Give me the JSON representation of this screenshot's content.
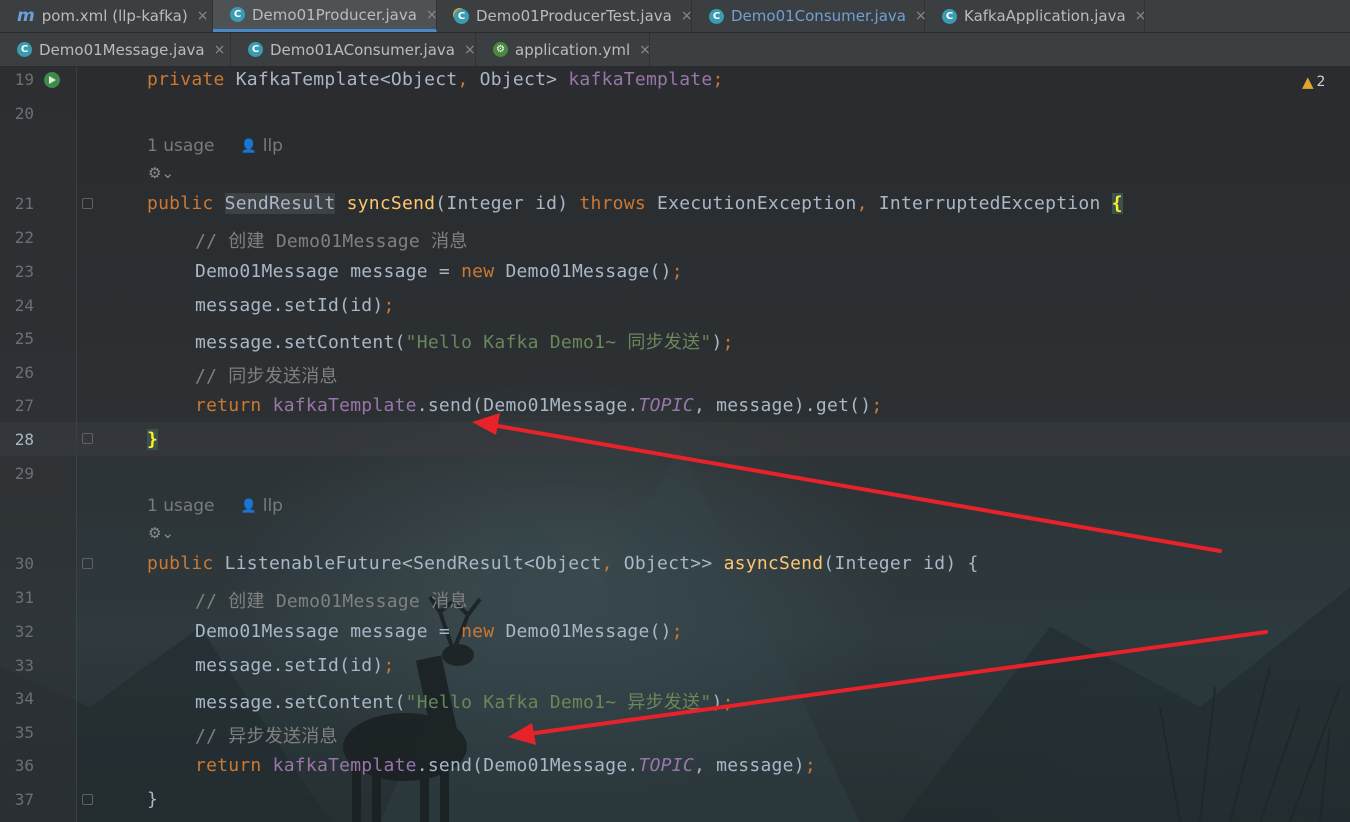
{
  "tabs_row1": [
    {
      "label": "pom.xml (llp-kafka)",
      "icon": "maven-icon",
      "glyph": "m",
      "active": false
    },
    {
      "label": "Demo01Producer.java",
      "icon": "class-icon",
      "glyph": "C",
      "active": true
    },
    {
      "label": "Demo01ProducerTest.java",
      "icon": "test-class-icon",
      "glyph": "C",
      "active": false
    },
    {
      "label": "Demo01Consumer.java",
      "icon": "class-icon",
      "glyph": "C",
      "active": false
    },
    {
      "label": "KafkaApplication.java",
      "icon": "spring-boot-app-icon",
      "glyph": "C",
      "active": false
    }
  ],
  "tabs_row2": [
    {
      "label": "Demo01Message.java",
      "icon": "class-icon",
      "glyph": "C"
    },
    {
      "label": "Demo01AConsumer.java",
      "icon": "class-icon",
      "glyph": "C"
    },
    {
      "label": "application.yml",
      "icon": "yaml-icon",
      "glyph": "⚙"
    }
  ],
  "close_glyph": "×",
  "warning": {
    "count": "2",
    "icon": "warning-icon",
    "glyph": "▲"
  },
  "line_numbers": [
    "19",
    "20",
    "21",
    "22",
    "23",
    "24",
    "25",
    "26",
    "27",
    "28",
    "29",
    "30",
    "31",
    "32",
    "33",
    "34",
    "35",
    "36",
    "37"
  ],
  "current_line": "28",
  "inlay_hints": [
    {
      "usages": "1 usage",
      "author": "llp",
      "person_glyph": "👤",
      "ai_glyph": "⚙⌄"
    },
    {
      "usages": "1 usage",
      "author": "llp",
      "person_glyph": "👤",
      "ai_glyph": "⚙⌄"
    }
  ],
  "code": {
    "l19": {
      "kw": "private ",
      "type": "KafkaTemplate<Object",
      "sep1": ", ",
      "type2": "Object> ",
      "field": "kafkaTemplate",
      "semi": ";"
    },
    "l21": {
      "kw": "public ",
      "ret": "SendResult",
      "sp": " ",
      "method": "syncSend",
      "params": "(Integer id) ",
      "kw2": "throws ",
      "ex1": "ExecutionException",
      "sep": ", ",
      "ex2": "InterruptedException ",
      "brace": "{"
    },
    "l22": {
      "comment": "// 创建 Demo01Message 消息"
    },
    "l23": {
      "a": "Demo01Message message = ",
      "kw": "new ",
      "b": "Demo01Message()",
      "semi": ";"
    },
    "l24": {
      "a": "message.setId(id)",
      "semi": ";"
    },
    "l25": {
      "a": "message.setContent(",
      "str": "\"Hello Kafka Demo1~ 同步发送\"",
      "b": ")",
      "semi": ";"
    },
    "l26": {
      "comment": "// 同步发送消息"
    },
    "l27": {
      "kw": "return ",
      "field": "kafkaTemplate",
      "a": ".send(Demo01Message.",
      "const": "TOPIC",
      "b": ", message).get()",
      "semi": ";"
    },
    "l28": {
      "brace": "}"
    },
    "l30": {
      "kw": "public ",
      "type": "ListenableFuture<SendResult<Object",
      "sep1": ", ",
      "type2": "Object>> ",
      "method": "asyncSend",
      "params": "(Integer id) {"
    },
    "l31": {
      "comment": "// 创建 Demo01Message 消息"
    },
    "l32": {
      "a": "Demo01Message message = ",
      "kw": "new ",
      "b": "Demo01Message()",
      "semi": ";"
    },
    "l33": {
      "a": "message.setId(id)",
      "semi": ";"
    },
    "l34": {
      "a": "message.setContent(",
      "str": "\"Hello Kafka Demo1~ 异步发送\"",
      "b": ")",
      "semi": ";"
    },
    "l35": {
      "comment": "// 异步发送消息"
    },
    "l36": {
      "kw": "return ",
      "field": "kafkaTemplate",
      "a": ".send(Demo01Message.",
      "const": "TOPIC",
      "b": ", message)",
      "semi": ";"
    },
    "l37": {
      "brace": "}"
    }
  },
  "annotation_arrows": [
    {
      "name": "arrow-to-sync-send",
      "color": "#e8222a",
      "from_line": "21-22 right margin",
      "to": "line 27 kafkaTemplate.send"
    },
    {
      "name": "arrow-to-async-send",
      "color": "#e8222a",
      "from_line": "31 right margin",
      "to": "line 35 comment"
    }
  ],
  "colors": {
    "keyword": "#cc7832",
    "field": "#9876aa",
    "method": "#ffc66d",
    "string": "#6a8759",
    "comment": "#808080",
    "arrow": "#e8222a",
    "tab_underline": "#4a88c7"
  }
}
